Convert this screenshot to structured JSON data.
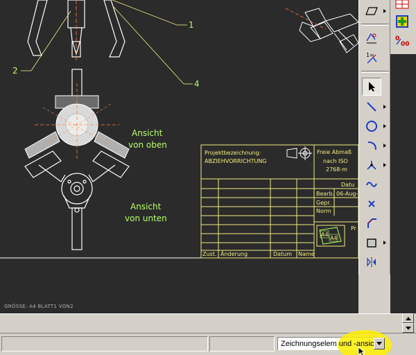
{
  "drawing": {
    "callouts": [
      "1",
      "2",
      "4"
    ],
    "view_top_label_1": "Ansicht",
    "view_top_label_2": "von oben",
    "view_bottom_label_1": "Ansicht",
    "view_bottom_label_2": "von unten",
    "status_text": "GRÖSSE: A4    BLATT1   VON2"
  },
  "title_block": {
    "project_label": "Projektbezeichnung:",
    "project_name": "ABZIEHVORRICHTUNG",
    "tolerance_line1": "Freie Abmaß",
    "tolerance_line2": "nach ISO",
    "tolerance_line3": "2768-m",
    "datum_header": "Datu",
    "bearb_label": "Bearb.",
    "bearb_date": "06-Aug-",
    "gepr_label": "Gepr.",
    "norm_label": "Norm",
    "pr_label": "Pr",
    "logo_a": "A4",
    "logo_b": "A4",
    "zust_label": "Zust.",
    "aenderung_label": "Änderung",
    "datum_label": "Datum",
    "name_label": "Name"
  },
  "toolbar": {
    "items": [
      {
        "name": "parallelogram-icon"
      },
      {
        "name": "dimension-icon"
      },
      {
        "name": "hatch-icon"
      },
      {
        "name": "select-arrow-icon"
      },
      {
        "name": "line-icon"
      },
      {
        "name": "circle-icon"
      },
      {
        "name": "arc-icon"
      },
      {
        "name": "point-icon"
      },
      {
        "name": "spline-icon"
      },
      {
        "name": "cross-icon"
      },
      {
        "name": "chamfer-icon"
      },
      {
        "name": "rectangle-icon"
      },
      {
        "name": "mirror-icon"
      }
    ]
  },
  "status": {
    "layer_filter": "Zeichnungselem und -ansic"
  },
  "colors": {
    "canvas": "#2b2b2b",
    "drawing_white": "#ffffff",
    "title_block": "#f2ee80",
    "annotation": "#b8ff66",
    "highlight": "#fff000"
  }
}
